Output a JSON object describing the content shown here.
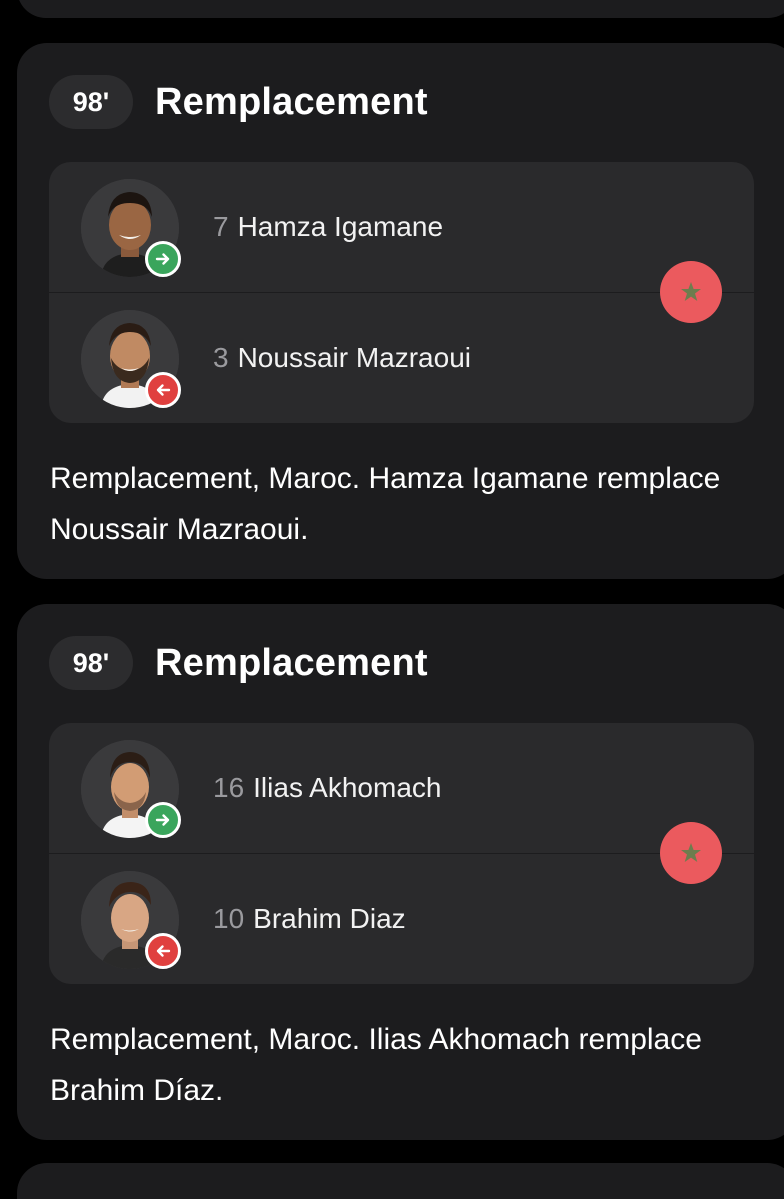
{
  "events": [
    {
      "minute": "98'",
      "title": "Remplacement",
      "player_in": {
        "number": "7",
        "name": "Hamza Igamane"
      },
      "player_out": {
        "number": "3",
        "name": "Noussair Mazraoui"
      },
      "description": "Remplacement, Maroc. Hamza Igamane remplace Noussair Mazraoui."
    },
    {
      "minute": "98'",
      "title": "Remplacement",
      "player_in": {
        "number": "16",
        "name": "Ilias Akhomach"
      },
      "player_out": {
        "number": "10",
        "name": "Brahim Diaz"
      },
      "description": "Remplacement, Maroc. Ilias Akhomach remplace Brahim Díaz."
    }
  ],
  "icons": {
    "sub_in": "arrow-right-icon",
    "sub_out": "arrow-left-icon",
    "team": "morocco-flag-icon"
  },
  "colors": {
    "background": "#000000",
    "card": "#1c1c1e",
    "players_box": "#2a2a2c",
    "sub_in": "#3aa55c",
    "sub_out": "#e0403f",
    "team_badge": "#eb5a5e",
    "team_star": "#6d7d4e"
  }
}
